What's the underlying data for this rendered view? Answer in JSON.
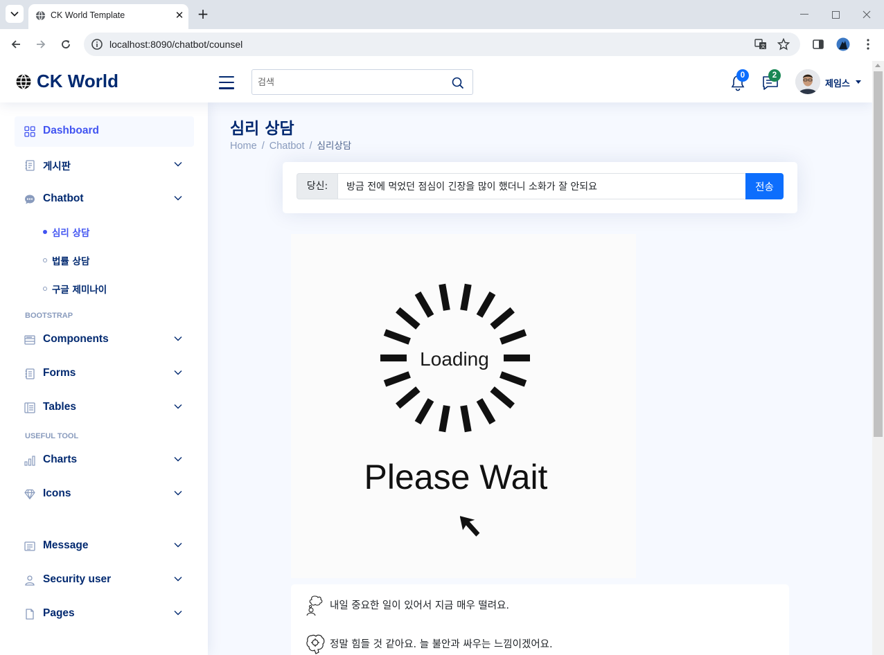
{
  "browser": {
    "tab_title": "CK World Template",
    "url": "localhost:8090/chatbot/counsel"
  },
  "header": {
    "logo_text": "CK World",
    "search_placeholder": "검색",
    "notifications_count": "0",
    "messages_count": "2",
    "profile_name": "제임스"
  },
  "sidebar": {
    "items": [
      {
        "label": "Dashboard",
        "icon": "grid-icon"
      },
      {
        "label": "게시판",
        "icon": "journal-icon"
      },
      {
        "label": "Chatbot",
        "icon": "chat-dots-icon"
      }
    ],
    "chatbot_sub": [
      {
        "label": "심리 상담"
      },
      {
        "label": "법률 상담"
      },
      {
        "label": "구글 제미나이"
      }
    ],
    "heading_bootstrap": "BOOTSTRAP",
    "bootstrap_items": [
      {
        "label": "Components",
        "icon": "menu-button-icon"
      },
      {
        "label": "Forms",
        "icon": "journal-text-icon"
      },
      {
        "label": "Tables",
        "icon": "layout-text-icon"
      }
    ],
    "heading_useful": "USEFUL TOOL",
    "useful_items": [
      {
        "label": "Charts",
        "icon": "bar-chart-icon"
      },
      {
        "label": "Icons",
        "icon": "gem-icon"
      }
    ],
    "bottom_items": [
      {
        "label": "Message",
        "icon": "card-list-icon"
      },
      {
        "label": "Security user",
        "icon": "person-icon"
      },
      {
        "label": "Pages",
        "icon": "file-icon"
      }
    ]
  },
  "main": {
    "page_title": "심리 상담",
    "breadcrumb": [
      "Home",
      "Chatbot",
      "심리상담"
    ],
    "input_label": "당신:",
    "input_value": "방금 전에 먹었던 점심이 긴장을 많이 했더니 소화가 잘 안되요",
    "send_label": "전송",
    "loading_text": "Loading",
    "wait_text": "Please Wait",
    "responses": [
      {
        "text": "내일 중요한 일이 있어서 지금 매우 떨려요.",
        "icon": "user-thought-icon"
      },
      {
        "text": "정말 힘들 것 같아요. 늘 불안과 싸우는 느낌이겠어요.",
        "icon": "robot-brain-icon"
      }
    ]
  },
  "colors": {
    "brand": "#012970",
    "accent": "#4154f1",
    "primary_button": "#0d6efd",
    "success_badge": "#198754"
  }
}
